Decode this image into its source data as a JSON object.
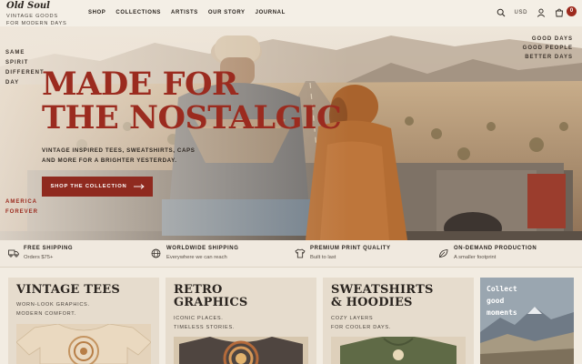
{
  "header": {
    "brand": "Old Soul",
    "tagline_line1": "VINTAGE GOODS",
    "tagline_line2": "FOR MODERN DAYS",
    "nav": [
      "SHOP",
      "COLLECTIONS",
      "ARTISTS",
      "OUR STORY",
      "JOURNAL"
    ],
    "currency": "USD",
    "cart_count": "0",
    "icons": [
      "search-icon",
      "account-icon",
      "cart-icon"
    ]
  },
  "hero": {
    "side_left": [
      "SAME",
      "SPIRIT",
      "DIFFERENT",
      "DAY"
    ],
    "side_right": [
      "GOOD DAYS",
      "GOOD PEOPLE",
      "BETTER DAYS"
    ],
    "headline_line1": "MADE FOR",
    "headline_line2": "THE NOSTALGIC",
    "subcopy_line1": "VINTAGE INSPIRED TEES, SWEATSHIRTS, CAPS",
    "subcopy_line2": "AND MORE FOR A BRIGHTER YESTERDAY.",
    "cta_label": "SHOP THE COLLECTION",
    "side_bottom": [
      "AMERICA",
      "FOREVER"
    ]
  },
  "features": [
    {
      "title": "FREE SHIPPING",
      "subtitle": "Orders $75+",
      "icon": "truck-icon"
    },
    {
      "title": "WORLDWIDE SHIPPING",
      "subtitle": "Everywhere we can reach",
      "icon": "globe-icon"
    },
    {
      "title": "PREMIUM PRINT QUALITY",
      "subtitle": "Built to last",
      "icon": "shirt-icon"
    },
    {
      "title": "ON-DEMAND PRODUCTION",
      "subtitle": "A smaller footprint",
      "icon": "leaf-icon"
    }
  ],
  "cards": [
    {
      "title_line1": "VINTAGE TEES",
      "title_line2": "",
      "sub_line1": "WORN-LOOK GRAPHICS.",
      "sub_line2": "MODERN COMFORT."
    },
    {
      "title_line1": "RETRO",
      "title_line2": "GRAPHICS",
      "sub_line1": "ICONIC PLACES.",
      "sub_line2": "TIMELESS STORIES."
    },
    {
      "title_line1": "SWEATSHIRTS",
      "title_line2": "& HOODIES",
      "sub_line1": "COZY LAYERS",
      "sub_line2": "FOR COOLER DAYS."
    }
  ],
  "promo": {
    "line1": "Collect",
    "line2": "good",
    "line3": "moments"
  },
  "colors": {
    "accent_red": "#9b2b1f",
    "cta_bg": "#8f2a1f",
    "header_bg": "#f4efe6",
    "card_bg": "#e6dccd"
  }
}
